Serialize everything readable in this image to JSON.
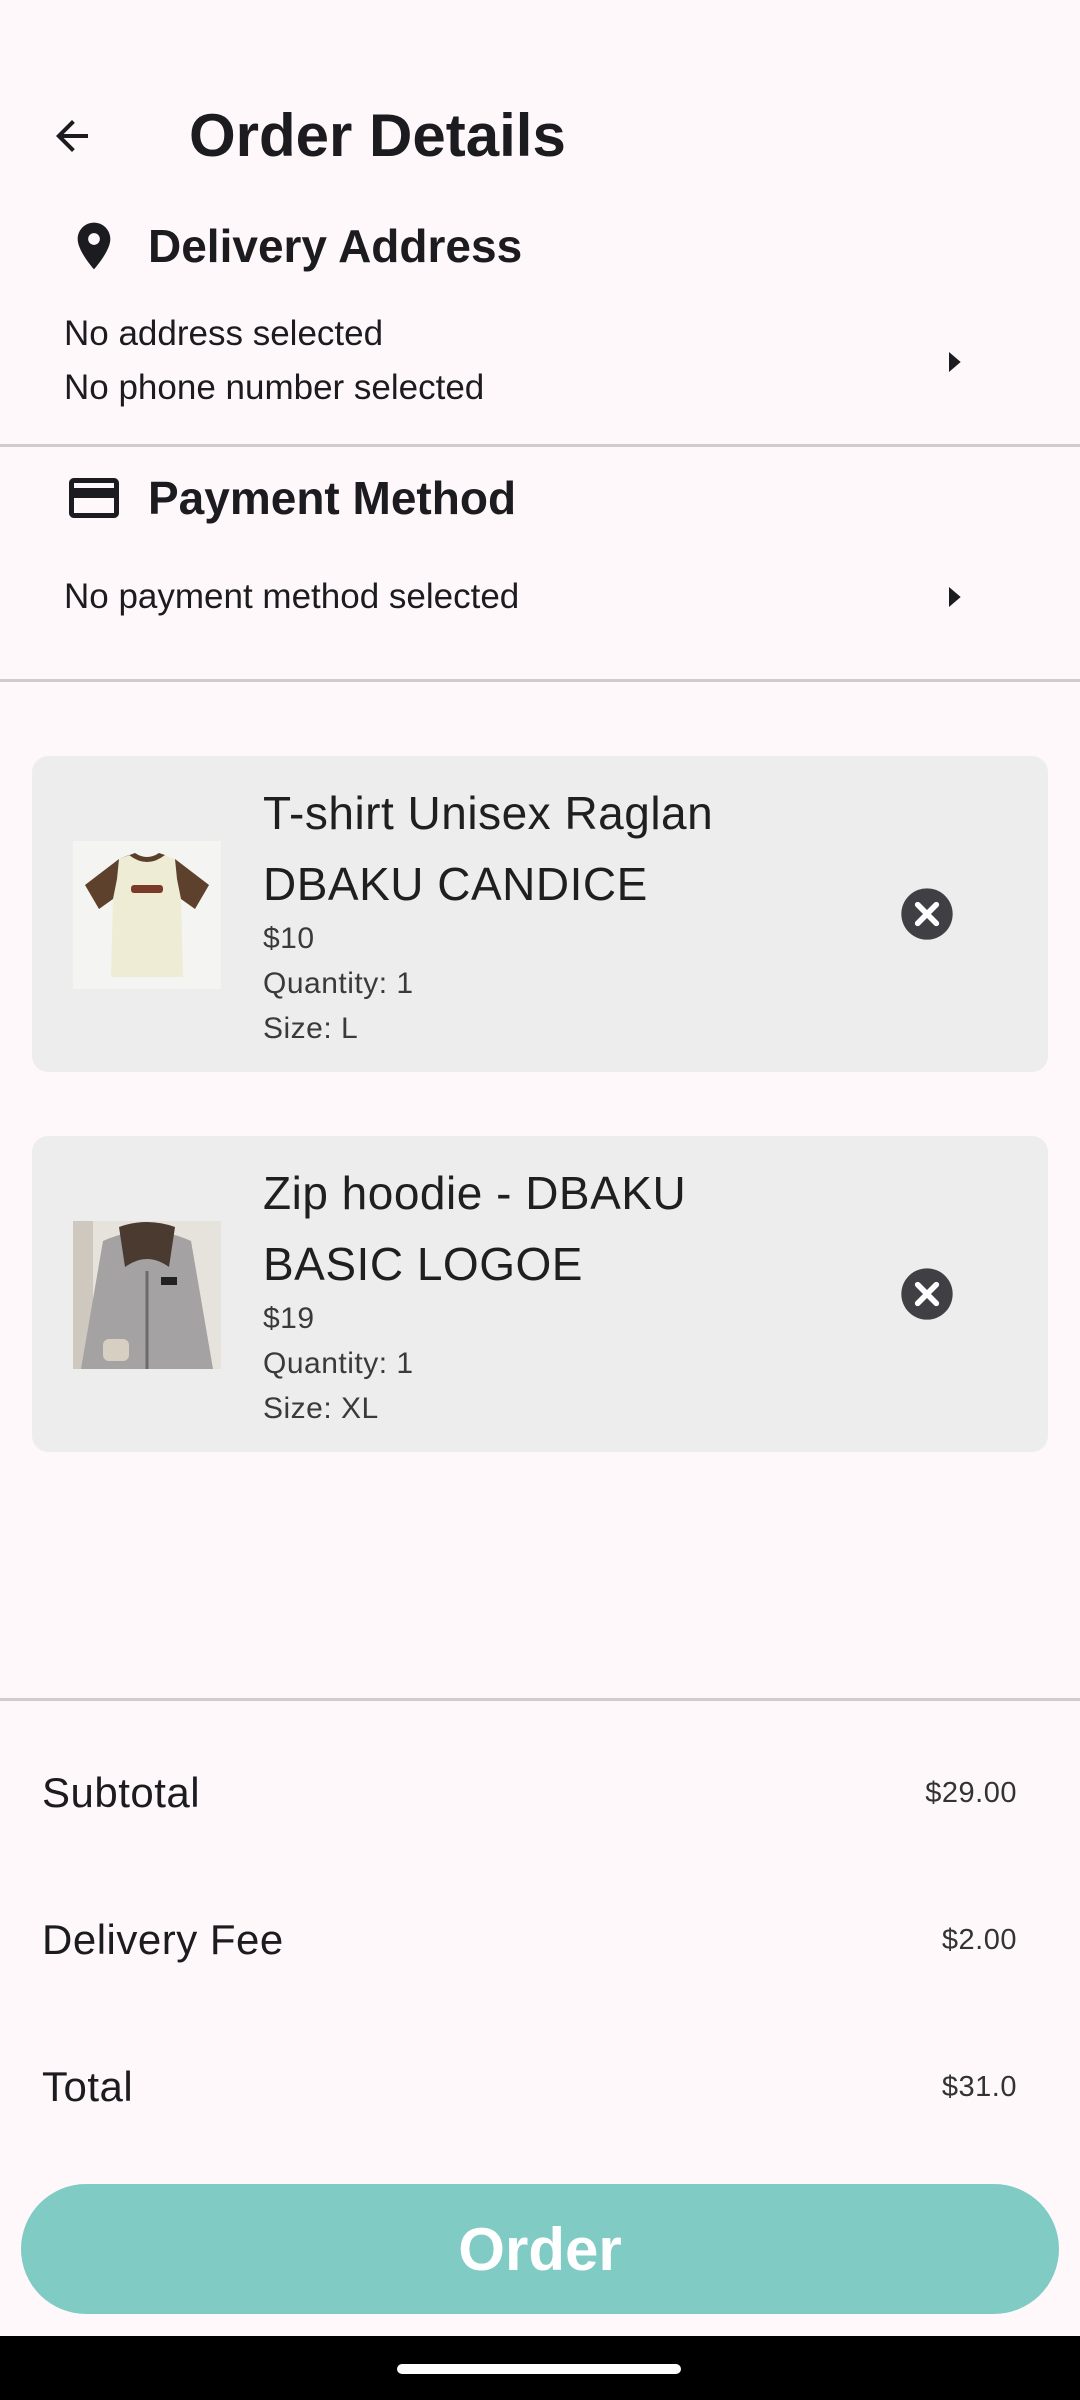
{
  "header": {
    "title": "Order Details",
    "back_icon": "arrow-back-icon"
  },
  "delivery": {
    "title": "Delivery Address",
    "icon": "location-pin-icon",
    "address": "No address selected",
    "phone": "No phone number selected"
  },
  "payment": {
    "title": "Payment Method",
    "icon": "credit-card-icon",
    "method": "No payment method selected"
  },
  "items": [
    {
      "name": "T-shirt Unisex Raglan DBAKU CANDICE",
      "price": "$10",
      "quantity": "Quantity: 1",
      "size": "Size: L",
      "image": "tshirt-product-image"
    },
    {
      "name": "Zip hoodie - DBAKU BASIC LOGOE",
      "price": "$19",
      "quantity": "Quantity: 1",
      "size": "Size: XL",
      "image": "hoodie-product-image"
    }
  ],
  "summary": {
    "subtotal_label": "Subtotal",
    "subtotal_value": "$29.00",
    "delivery_label": "Delivery Fee",
    "delivery_value": "$2.00",
    "total_label": "Total",
    "total_value": "$31.0"
  },
  "order_button": {
    "label": "Order",
    "color": "#80cbc4"
  },
  "colors": {
    "background": "#fef8fb",
    "card": "#eeeded",
    "divider": "#cfcbcf",
    "accent": "#80cbc4"
  }
}
